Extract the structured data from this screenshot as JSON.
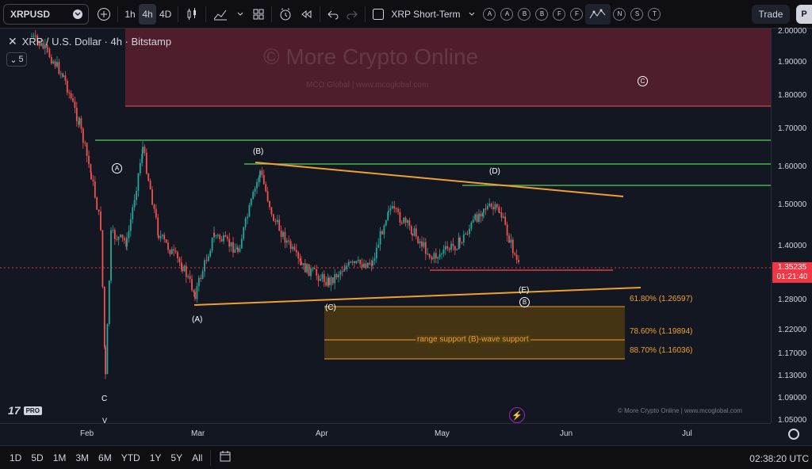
{
  "toolbar": {
    "symbol": "XRPUSD",
    "intervals": [
      "1h",
      "4h",
      "4D"
    ],
    "active_interval": "4h",
    "layout_name": "XRP Short-Term",
    "drawing_letters": [
      "A",
      "A",
      "B",
      "B",
      "F",
      "F"
    ],
    "extra_letters": [
      "N",
      "S",
      "T"
    ],
    "trade_label": "Trade",
    "publish_label": "P",
    "accent": "#2962ff"
  },
  "legend": {
    "title": "XRP / U.S. Dollar · 4h · Bitstamp",
    "indicator_count": "5"
  },
  "watermark": {
    "main": "© More Crypto Online",
    "sub": "MCO Global  |  www.mcoglobal.com"
  },
  "copyright": "© More Crypto Online  |  www.mcoglobal.com",
  "logo": {
    "text": "17",
    "badge": "PRO"
  },
  "wave_labels": {
    "A_paren": "(A)",
    "B_paren": "(B)",
    "C_paren": "(C)",
    "D_paren": "(D)",
    "E_paren": "(E)",
    "A_circ": "A",
    "B_circ": "B",
    "C_circ": "C",
    "c_low": "C",
    "v_low": "V"
  },
  "range_support": "range support (B)-wave support",
  "fib_levels": [
    {
      "label": "61.80% (1.26597)"
    },
    {
      "label": "78.60% (1.19894)"
    },
    {
      "label": "88.70% (1.16036)"
    }
  ],
  "price_axis": {
    "ticks": [
      "2.00000",
      "1.90000",
      "1.80000",
      "1.70000",
      "1.60000",
      "1.50000",
      "1.40000",
      "1.28000",
      "1.22000",
      "1.17000",
      "1.13000",
      "1.09000",
      "1.05000"
    ],
    "last_price": "1.35235",
    "countdown": "01:21:40",
    "last_color": "#f23645"
  },
  "time_axis": {
    "ticks": [
      "Feb",
      "Mar",
      "Apr",
      "May",
      "Jun",
      "Jul"
    ]
  },
  "bottom": {
    "ranges": [
      "1D",
      "5D",
      "1M",
      "3M",
      "6M",
      "YTD",
      "1Y",
      "5Y",
      "All"
    ],
    "clock": "02:38:20 UTC"
  },
  "colors": {
    "up": "#26a69a",
    "down": "#ef5350",
    "trendline": "#f0a030",
    "horizontal": "#4caf50",
    "resistance_zone": "#5c1f2e"
  }
}
